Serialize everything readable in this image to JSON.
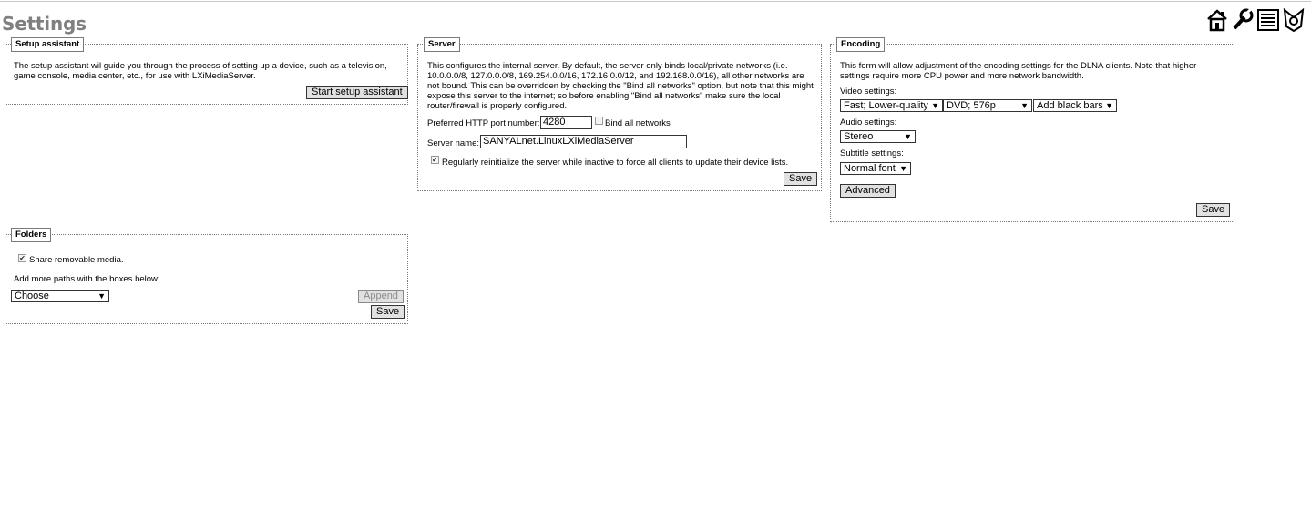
{
  "header": {
    "title": "Settings"
  },
  "toolbar_icons": [
    "home-icon",
    "tools-icon",
    "list-icon",
    "lxi-logo-icon"
  ],
  "setup_assistant": {
    "legend": "Setup assistant",
    "description": "The setup assistant wil guide you through the process of setting up a device, such as a television, game console, media center, etc., for use with LXiMediaServer.",
    "start_button": "Start setup assistant"
  },
  "server": {
    "legend": "Server",
    "description": "This configures the internal server. By default, the server only binds local/private networks (i.e. 10.0.0.0/8, 127.0.0.0/8, 169.254.0.0/16, 172.16.0.0/12, and 192.168.0.0/16), all other networks are not bound. This can be overridden by checking the \"Bind all networks\" option, but note that this might expose this server to the internet; so before enabling \"Bind all networks\" make sure the local router/firewall is properly configured.",
    "port_label": "Preferred HTTP port number:",
    "port_value": "4280",
    "bind_all_label": "Bind all networks",
    "bind_all_checked": false,
    "name_label": "Server name:",
    "name_value": "SANYALnet.LinuxLXiMediaServer",
    "reinit_label": "Regularly reinitialize the server while inactive to force all clients to update their device lists.",
    "reinit_checked": true,
    "save_button": "Save"
  },
  "encoding": {
    "legend": "Encoding",
    "description": "This form will allow adjustment of the encoding settings for the DLNA clients. Note that higher settings require more CPU power and more network bandwidth.",
    "video_label": "Video settings:",
    "video_quality": "Fast; Lower-quality",
    "video_format": "DVD; 576p",
    "video_bars": "Add black bars",
    "audio_label": "Audio settings:",
    "audio_value": "Stereo",
    "subtitle_label": "Subtitle settings:",
    "subtitle_value": "Normal font",
    "advanced_button": "Advanced",
    "save_button": "Save"
  },
  "folders": {
    "legend": "Folders",
    "share_removable_label": "Share removable media.",
    "share_removable_checked": true,
    "add_paths_label": "Add more paths with the boxes below:",
    "path_select": "Choose",
    "append_button": "Append",
    "save_button": "Save"
  }
}
